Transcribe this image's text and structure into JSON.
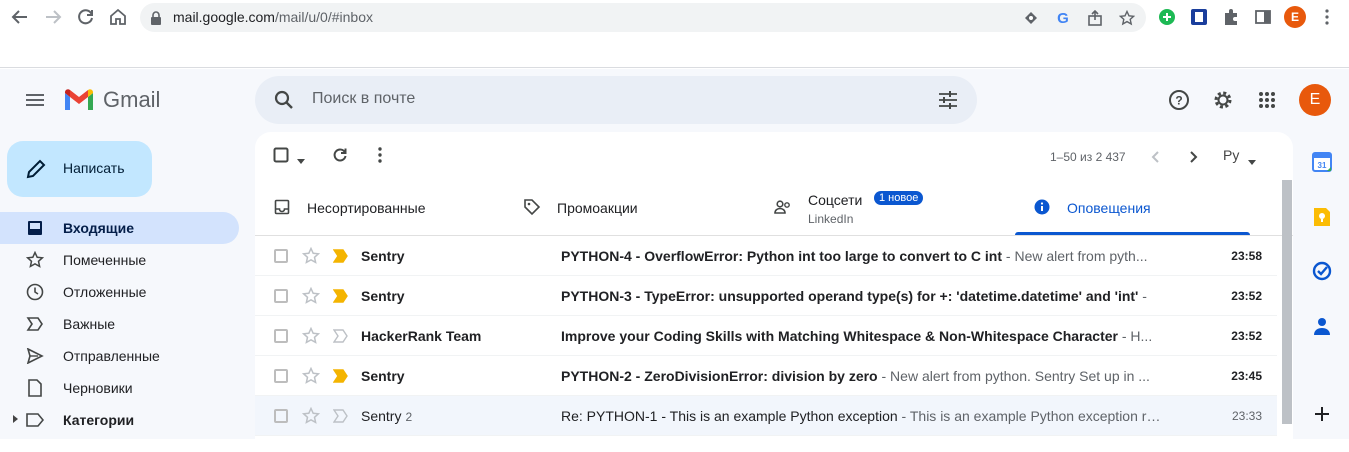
{
  "browser": {
    "url_host": "mail.google.com",
    "url_path": "/mail/u/0/#inbox",
    "profile_initial": "E"
  },
  "app": {
    "logo_text": "Gmail",
    "search_placeholder": "Поиск в почте",
    "avatar_initial": "E"
  },
  "compose": {
    "label": "Написать"
  },
  "sidebar": {
    "items": [
      {
        "label": "Входящие",
        "icon": "inbox-icon",
        "active": true
      },
      {
        "label": "Помеченные",
        "icon": "star-icon"
      },
      {
        "label": "Отложенные",
        "icon": "clock-icon"
      },
      {
        "label": "Важные",
        "icon": "important-icon"
      },
      {
        "label": "Отправленные",
        "icon": "send-icon"
      },
      {
        "label": "Черновики",
        "icon": "draft-icon"
      },
      {
        "label": "Категории",
        "icon": "label-icon"
      }
    ]
  },
  "toolbar": {
    "pager": "1–50 из 2 437",
    "lang": "Ру"
  },
  "tabs": [
    {
      "label": "Несортированные",
      "icon": "inbox-tab-icon"
    },
    {
      "label": "Промоакции",
      "icon": "tag-icon"
    },
    {
      "label": "Соцсети",
      "icon": "people-icon",
      "sub": "LinkedIn",
      "badge": "1 новое"
    },
    {
      "label": "Оповещения",
      "icon": "info-icon",
      "active": true
    }
  ],
  "emails": [
    {
      "sender": "Sentry",
      "count": "",
      "subject": "PYTHON-4 - OverflowError: Python int too large to convert to C int",
      "snippet": " - New alert from pyth...",
      "time": "23:58",
      "unread": true,
      "important": true
    },
    {
      "sender": "Sentry",
      "count": "",
      "subject": "PYTHON-3 - TypeError: unsupported operand type(s) for +: 'datetime.datetime' and 'int'",
      "snippet": " -",
      "time": "23:52",
      "unread": true,
      "important": true
    },
    {
      "sender": "HackerRank Team",
      "count": "",
      "subject": "Improve your Coding Skills with Matching Whitespace & Non-Whitespace Character",
      "snippet": " - H...",
      "time": "23:52",
      "unread": true,
      "important": false
    },
    {
      "sender": "Sentry",
      "count": "",
      "subject": "PYTHON-2 - ZeroDivisionError: division by zero",
      "snippet": " - New alert from python. Sentry Set up in ...",
      "time": "23:45",
      "unread": true,
      "important": true
    },
    {
      "sender": "Sentry",
      "count": "2",
      "subject": "Re: PYTHON-1 - This is an example Python exception",
      "snippet": " - This is an example Python exception ra...",
      "time": "23:33",
      "unread": false,
      "important": false
    }
  ],
  "colors": {
    "accent": "#0b57d0",
    "compose_bg": "#c2e7ff",
    "important": "#f4b400",
    "avatar": "#e8590c"
  }
}
